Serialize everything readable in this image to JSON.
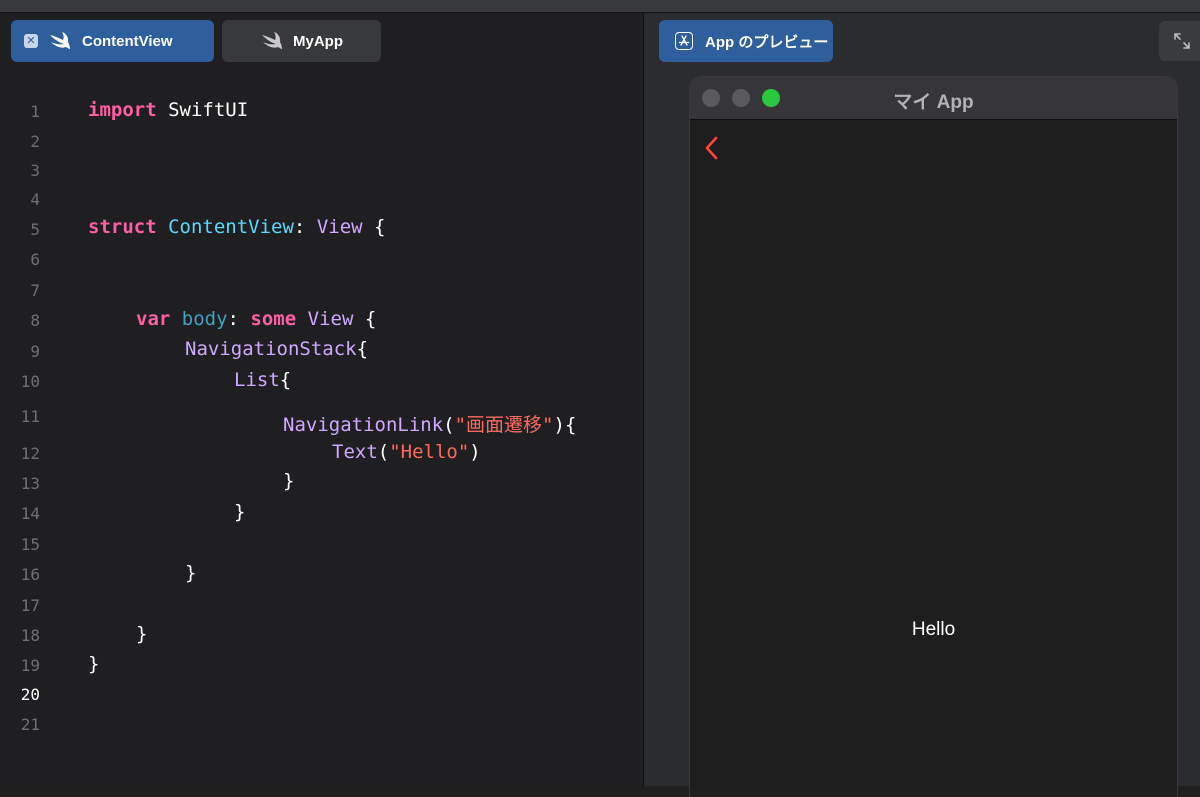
{
  "editor": {
    "tabs": [
      {
        "label": "ContentView",
        "close_glyph": "✕",
        "icon": "swift-icon",
        "active": true
      },
      {
        "label": "MyApp",
        "icon": "swift-icon",
        "active": false
      }
    ],
    "line_numbers": [
      "1",
      "2",
      "3",
      "4",
      "5",
      "6",
      "7",
      "8",
      "9",
      "10",
      "11",
      "12",
      "13",
      "14",
      "15",
      "16",
      "17",
      "18",
      "19",
      "20",
      "21"
    ],
    "active_line": "20",
    "code": {
      "l1": {
        "kw": "import",
        "rest": " SwiftUI"
      },
      "l5": {
        "kw": "struct",
        "name": " ContentView",
        "colon": ": ",
        "type": "View",
        "brace": " {"
      },
      "l8": {
        "kw": "var",
        "prop": " body",
        "colon": ": ",
        "kw2": "some",
        "type": " View",
        "brace": " {"
      },
      "l9": {
        "type": "NavigationStack",
        "brace": "{"
      },
      "l10": {
        "type": "List",
        "brace": "{"
      },
      "l11": {
        "type": "NavigationLink",
        "open": "(",
        "str": "\"画面遷移\"",
        "close": "){"
      },
      "l12": {
        "type": "Text",
        "open": "(",
        "str": "\"Hello\"",
        "close": ")"
      },
      "l13": "}",
      "l14": "}",
      "l16": "}",
      "l18": "}",
      "l19": "}"
    }
  },
  "preview": {
    "button_label": "App のプレビュー",
    "button_icon": "app-store-icon",
    "expand_icon": "expand-icon",
    "window_title": "マイ App",
    "back_icon": "chevron-left-icon",
    "content_text": "Hello"
  },
  "colors": {
    "keyword": "#fc5fa3",
    "type_decl": "#5dd8ff",
    "type": "#d0a8ff",
    "property": "#41a1c0",
    "string": "#fc6a5d",
    "accent": "#2f5e9c",
    "back_chevron": "#ff453a",
    "zoom_light": "#29c83f"
  }
}
